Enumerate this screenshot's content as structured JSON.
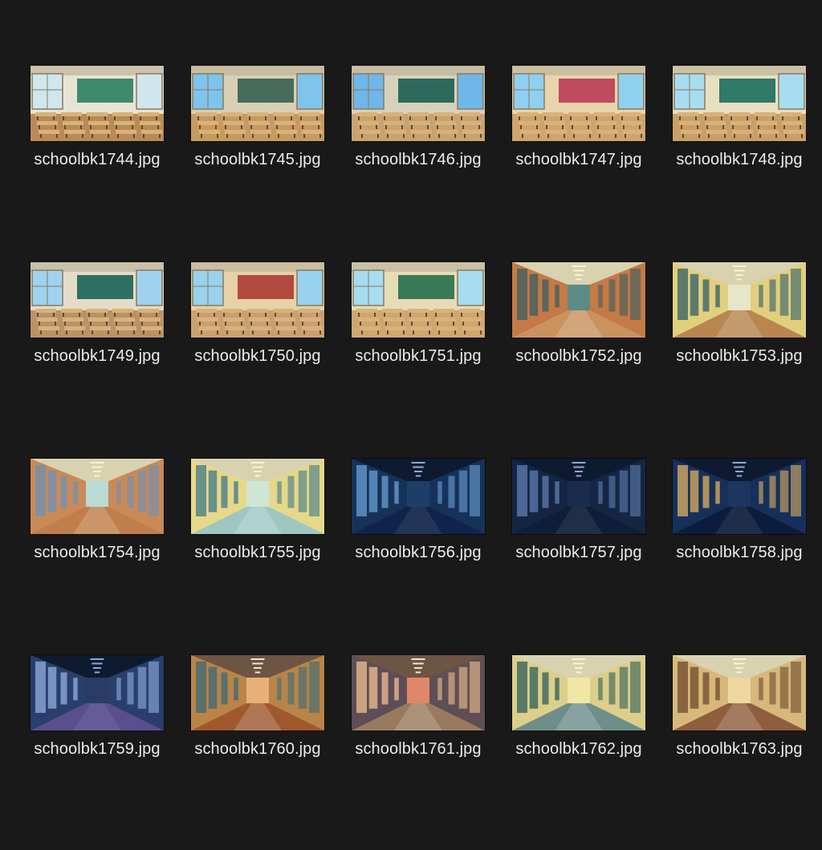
{
  "files": [
    {
      "name": "schoolbk1744.jpg",
      "scene": "classroom",
      "sky": "#cfe6ef",
      "wall": "#e8e4d4",
      "floor": "#b98a56",
      "accent": "#3f8a6f"
    },
    {
      "name": "schoolbk1745.jpg",
      "scene": "classroom",
      "sky": "#7ec4ec",
      "wall": "#d9cfb3",
      "floor": "#c79a60",
      "accent": "#466b5a"
    },
    {
      "name": "schoolbk1746.jpg",
      "scene": "classroom",
      "sky": "#6fb6ea",
      "wall": "#d6d1bd",
      "floor": "#c8a370",
      "accent": "#2e6a5c"
    },
    {
      "name": "schoolbk1747.jpg",
      "scene": "classroom",
      "sky": "#8fd0f0",
      "wall": "#e9d5ad",
      "floor": "#d0a46c",
      "accent": "#c04a60"
    },
    {
      "name": "schoolbk1748.jpg",
      "scene": "classroom",
      "sky": "#a8dcf0",
      "wall": "#e6dfc0",
      "floor": "#c8a066",
      "accent": "#2f7a68"
    },
    {
      "name": "schoolbk1749.jpg",
      "scene": "classroom",
      "sky": "#9fd2ef",
      "wall": "#e4dcc8",
      "floor": "#b99266",
      "accent": "#2f6f63"
    },
    {
      "name": "schoolbk1750.jpg",
      "scene": "classroom",
      "sky": "#98d2ee",
      "wall": "#e6d2a6",
      "floor": "#caa070",
      "accent": "#b24a40"
    },
    {
      "name": "schoolbk1751.jpg",
      "scene": "classroom",
      "sky": "#a6dcf0",
      "wall": "#e6dcb8",
      "floor": "#cfa66e",
      "accent": "#3b7a58"
    },
    {
      "name": "schoolbk1752.jpg",
      "scene": "hallway",
      "sky": "#5c8a86",
      "wall": "#c47a45",
      "floor": "#c9925e",
      "accent": "#3a5e64"
    },
    {
      "name": "schoolbk1753.jpg",
      "scene": "hallway",
      "sky": "#e8e6c8",
      "wall": "#e2cf7e",
      "floor": "#b8864e",
      "accent": "#2f5e6a"
    },
    {
      "name": "schoolbk1754.jpg",
      "scene": "hallway",
      "sky": "#b9dbd6",
      "wall": "#c98a58",
      "floor": "#c07e4a",
      "accent": "#6d8fb8"
    },
    {
      "name": "schoolbk1755.jpg",
      "scene": "hallway",
      "sky": "#cfe6d6",
      "wall": "#e6d88a",
      "floor": "#9fc7c2",
      "accent": "#3f7a8a"
    },
    {
      "name": "schoolbk1756.jpg",
      "scene": "night",
      "sky": "#1e3e6a",
      "wall": "#173259",
      "floor": "#10244a",
      "accent": "#6aa0d6"
    },
    {
      "name": "schoolbk1757.jpg",
      "scene": "night",
      "sky": "#1a2c4e",
      "wall": "#142644",
      "floor": "#0f1d38",
      "accent": "#5f7eb0"
    },
    {
      "name": "schoolbk1758.jpg",
      "scene": "night",
      "sky": "#1c3660",
      "wall": "#16305a",
      "floor": "#0c1c3c",
      "accent": "#e0b060"
    },
    {
      "name": "schoolbk1759.jpg",
      "scene": "night",
      "sky": "#2a3c66",
      "wall": "#2a3e6c",
      "floor": "#5a4e8e",
      "accent": "#8fb0e0"
    },
    {
      "name": "schoolbk1760.jpg",
      "scene": "sunset",
      "sky": "#e8b078",
      "wall": "#b88448",
      "floor": "#a0582e",
      "accent": "#3a6a7a"
    },
    {
      "name": "schoolbk1761.jpg",
      "scene": "sunset",
      "sky": "#e0866a",
      "wall": "#5e4e56",
      "floor": "#9a7a5e",
      "accent": "#f0c090"
    },
    {
      "name": "schoolbk1762.jpg",
      "scene": "hallway",
      "sky": "#f0e6a6",
      "wall": "#dccf8a",
      "floor": "#6e8e8a",
      "accent": "#2e5e5a"
    },
    {
      "name": "schoolbk1763.jpg",
      "scene": "hallway",
      "sky": "#f0d6a0",
      "wall": "#d6b87a",
      "floor": "#8e5e3e",
      "accent": "#6e4a2e"
    }
  ]
}
